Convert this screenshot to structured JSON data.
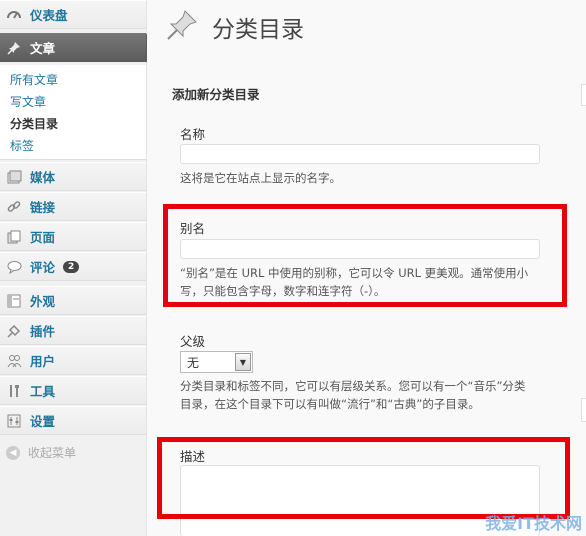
{
  "sidebar": {
    "dashboard": "仪表盘",
    "posts": "文章",
    "submenu": [
      "所有文章",
      "写文章",
      "分类目录",
      "标签"
    ],
    "media": "媒体",
    "links": "链接",
    "pages": "页面",
    "comments": "评论",
    "comments_count": "2",
    "appearance": "外观",
    "plugins": "插件",
    "users": "用户",
    "tools": "工具",
    "settings": "设置",
    "collapse": "收起菜单"
  },
  "main": {
    "title": "分类目录",
    "section_title": "添加新分类目录",
    "name_label": "名称",
    "name_desc": "这将是它在站点上显示的名字。",
    "slug_label": "别名",
    "slug_desc_1": "“别名”是在 URL 中使用的别称，它可以令 URL 更美观。通常使用小",
    "slug_desc_2": "写，只能包含字母，数字和连字符（-）。",
    "parent_label": "父级",
    "parent_value": "无",
    "parent_desc_1": "分类目录和标签不同，它可以有层级关系。您可以有一个“音乐”分类",
    "parent_desc_2": "目录，在这个目录下可以有叫做“流行”和“古典”的子目录。",
    "desc_label": "描述"
  },
  "watermark": "我爱IT技术网",
  "colors": {
    "highlight": "#e8000b",
    "link": "#21759b",
    "current_menu": "#5b5b5b"
  }
}
